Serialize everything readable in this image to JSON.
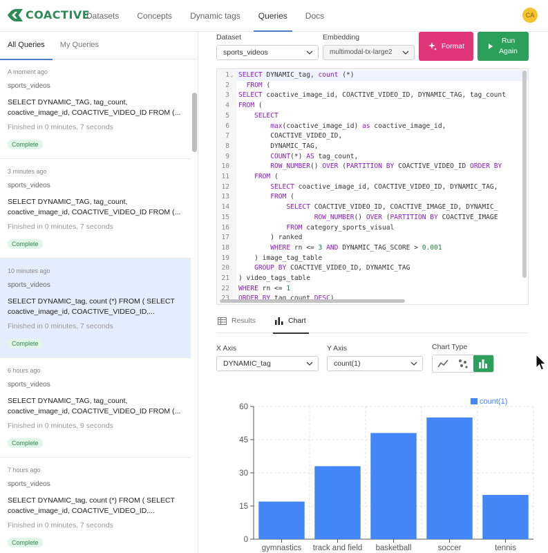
{
  "app": {
    "logo_text": "COACTIVE"
  },
  "nav": {
    "items": [
      {
        "label": "Datasets"
      },
      {
        "label": "Concepts"
      },
      {
        "label": "Dynamic tags"
      },
      {
        "label": "Queries",
        "active": true
      },
      {
        "label": "Docs"
      }
    ]
  },
  "user": {
    "initials": "CA"
  },
  "sidebar": {
    "tabs": [
      {
        "label": "All Queries",
        "active": true
      },
      {
        "label": "My Queries"
      }
    ],
    "queries": [
      {
        "time": "A moment ago",
        "dataset": "sports_videos",
        "sql": "SELECT DYNAMIC_TAG, tag_count, coactive_image_id, COACTIVE_VIDEO_ID FROM (...",
        "finished": "Finished in 0 minutes, 7 seconds",
        "status": "Complete"
      },
      {
        "time": "3 minutes ago",
        "dataset": "sports_videos",
        "sql": "SELECT DYNAMIC_TAG, tag_count, coactive_image_id, COACTIVE_VIDEO_ID FROM (...",
        "finished": "Finished in 0 minutes, 7 seconds",
        "status": "Complete"
      },
      {
        "time": "10 minutes ago",
        "dataset": "sports_videos",
        "sql": "SELECT DYNAMIC_tag, count (*) FROM ( SELECT coactive_image_id, COACTIVE_VIDEO_ID,...",
        "finished": "Finished in 0 minutes, 7 seconds",
        "status": "Complete",
        "selected": true
      },
      {
        "time": "6 hours ago",
        "dataset": "sports_videos",
        "sql": "SELECT DYNAMIC_TAG, tag_count, coactive_image_id, COACTIVE_VIDEO_ID FROM (...",
        "finished": "Finished in 0 minutes, 9 seconds",
        "status": "Complete"
      },
      {
        "time": "7 hours ago",
        "dataset": "sports_videos",
        "sql": "SELECT DYNAMIC_tag, count (*) FROM ( SELECT coactive_image_id, COACTIVE_VIDEO_ID,...",
        "finished": "Finished in 0 minutes, 7 seconds",
        "status": "Complete"
      }
    ]
  },
  "controls": {
    "dataset_label": "Dataset",
    "dataset_value": "sports_videos",
    "embedding_label": "Embedding",
    "embedding_value": "multimodal-tx-large2",
    "format_label": "Format",
    "run_label_1": "Run",
    "run_label_2": "Again"
  },
  "editor": {
    "lines": [
      "SELECT DYNAMIC_tag, count (*)",
      "  FROM (",
      "SELECT coactive_image_id, COACTIVE_VIDEO_ID, DYNAMIC_TAG, tag_count",
      "FROM (",
      "    SELECT",
      "        max(coactive_image_id) as coactive_image_id,",
      "        COACTIVE_VIDEO_ID,",
      "        DYNAMIC_TAG,",
      "        COUNT(*) AS tag_count,",
      "        ROW_NUMBER() OVER (PARTITION BY COACTIVE_VIDEO_ID ORDER BY",
      "    FROM (",
      "        SELECT coactive_image_id, COACTIVE_VIDEO_ID, DYNAMIC_TAG,",
      "        FROM (",
      "            SELECT COACTIVE_VIDEO_ID, COACTIVE_IMAGE_ID, DYNAMIC_",
      "                   ROW_NUMBER() OVER (PARTITION BY COACTIVE_IMAGE",
      "            FROM category_sports_visual",
      "        ) ranked",
      "        WHERE rn <= 3 AND DYNAMIC_TAG_SCORE > 0.001",
      "    ) image_tag_table",
      "    GROUP BY COACTIVE_VIDEO_ID, DYNAMIC_TAG",
      ") video_tags_table",
      "WHERE rn <= 1",
      "ORDER BY tag_count DESC)"
    ]
  },
  "results_tabs": [
    {
      "label": "Results"
    },
    {
      "label": "Chart",
      "active": true
    }
  ],
  "chart_controls": {
    "x_axis_label": "X Axis",
    "x_axis_value": "DYNAMIC_tag",
    "y_axis_label": "Y Axis",
    "y_axis_value": "count(1)",
    "chart_type_label": "Chart Type",
    "chart_types": [
      "line-chart-icon",
      "scatter-chart-icon",
      "bar-chart-icon"
    ],
    "active_type": "bar"
  },
  "chart_data": {
    "type": "bar",
    "categories": [
      "gymnastics",
      "track and field",
      "basketball",
      "soccer",
      "tennis"
    ],
    "series": [
      {
        "name": "count(1)",
        "values": [
          17,
          33,
          48,
          55,
          20
        ]
      }
    ],
    "ylim": [
      0,
      60
    ],
    "yticks": [
      0,
      15,
      30,
      45,
      60
    ],
    "grid": true,
    "legend": "top-right",
    "colors": {
      "bar": "#4287f5"
    }
  }
}
